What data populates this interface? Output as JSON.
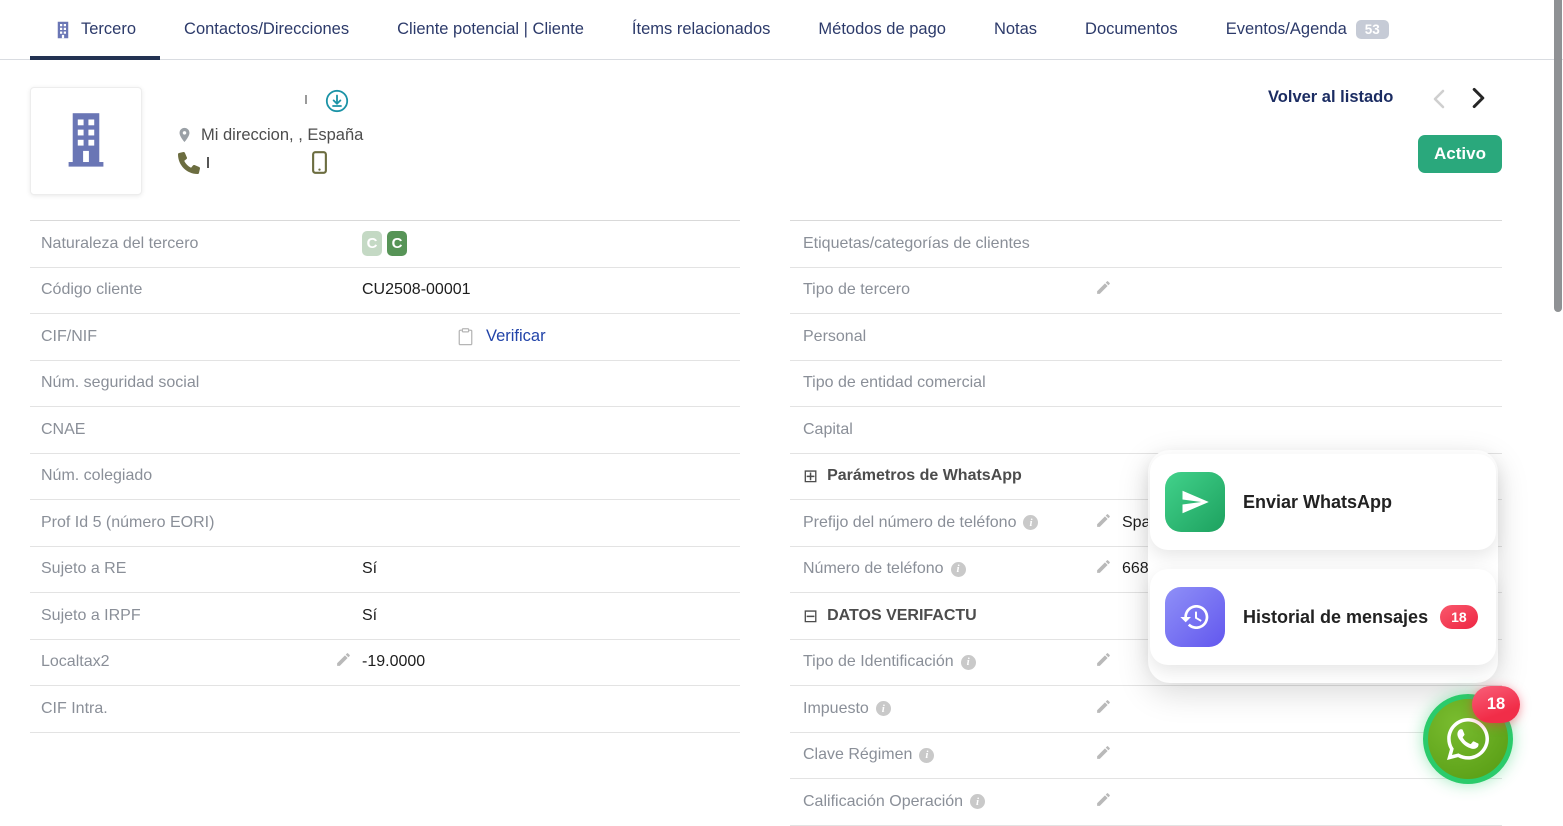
{
  "tabs": [
    {
      "label": "Tercero",
      "active": true
    },
    {
      "label": "Contactos/Direcciones"
    },
    {
      "label": "Cliente potencial | Cliente"
    },
    {
      "label": "Ítems relacionados"
    },
    {
      "label": "Métodos de pago"
    },
    {
      "label": "Notas"
    },
    {
      "label": "Documentos"
    },
    {
      "label": "Eventos/Agenda",
      "badge": "53"
    }
  ],
  "header": {
    "address": "Mi direccion, , España",
    "back_link": "Volver al listado",
    "status_badge": "Activo"
  },
  "left_table": {
    "rows": [
      {
        "label": "Naturaleza del tercero",
        "badges": [
          "C",
          "C"
        ]
      },
      {
        "label": "Código cliente",
        "value": "CU2508-00001"
      },
      {
        "label": "CIF/NIF",
        "link": "Verificar"
      },
      {
        "label": "Núm. seguridad social",
        "value": ""
      },
      {
        "label": "CNAE",
        "value": ""
      },
      {
        "label": "Núm. colegiado",
        "value": ""
      },
      {
        "label": "Prof Id 5 (número EORI)",
        "value": ""
      },
      {
        "label": "Sujeto a RE",
        "value": "Sí"
      },
      {
        "label": "Sujeto a IRPF",
        "value": "Sí"
      },
      {
        "label": "Localtax2",
        "value": "-19.0000"
      },
      {
        "label": "CIF Intra.",
        "value": ""
      }
    ]
  },
  "right_table": {
    "rows": [
      {
        "label": "Etiquetas/categorías de clientes"
      },
      {
        "label": "Tipo de tercero"
      },
      {
        "label": "Personal"
      },
      {
        "label": "Tipo de entidad comercial"
      },
      {
        "label": "Capital"
      },
      {
        "section": "Parámetros de WhatsApp",
        "glyph": "⊞"
      },
      {
        "label": "Prefijo del número de teléfono",
        "value": "Spa"
      },
      {
        "label": "Número de teléfono",
        "value": "668"
      },
      {
        "section": "DATOS VERIFACTU",
        "glyph": "⊟"
      },
      {
        "label": "Tipo de Identificación"
      },
      {
        "label": "Impuesto"
      },
      {
        "label": "Clave Régimen"
      },
      {
        "label": "Calificación Operación"
      }
    ]
  },
  "whatsapp_widget": {
    "send_label": "Enviar WhatsApp",
    "history_label": "Historial de mensajes",
    "history_badge": "18",
    "fab_badge": "18"
  },
  "colors": {
    "active_status_green": "#2aa87c",
    "tab_navy": "#2c3a6a",
    "send_icon_green": "#2fbf77",
    "history_icon_purple": "#6f6cf2",
    "alert_red": "#f12d48",
    "fab_green": "#5fa417",
    "fab_ring_green": "#2bcb6b",
    "link_blue": "#2244a9",
    "building_purple": "#6a76b5"
  }
}
